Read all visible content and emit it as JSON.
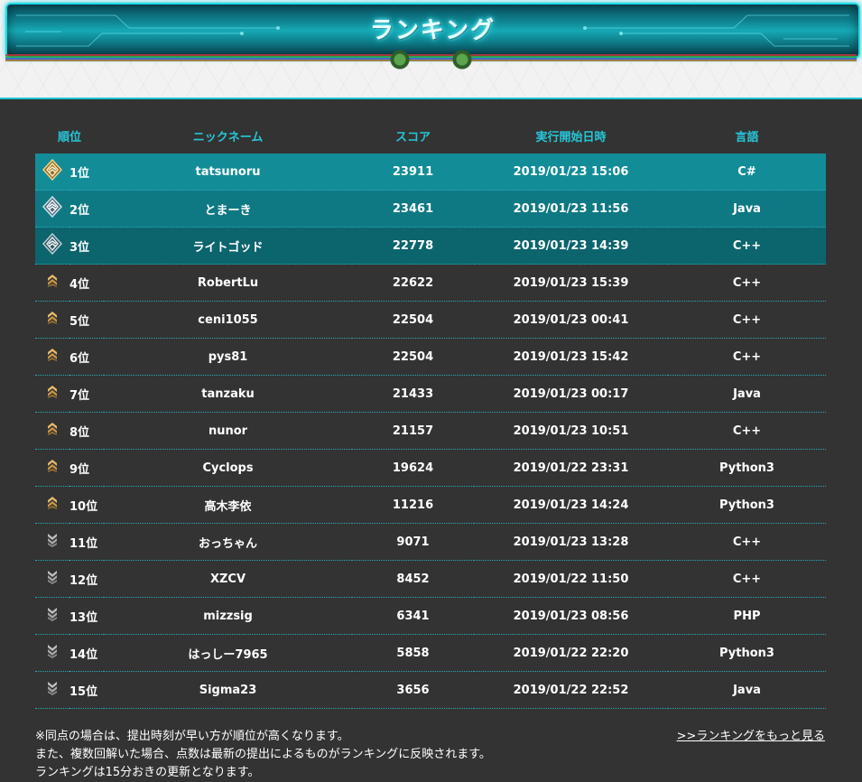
{
  "header": {
    "title": "ランキング"
  },
  "table": {
    "columns": [
      "順位",
      "ニックネーム",
      "スコア",
      "実行開始日時",
      "言語"
    ],
    "rows": [
      {
        "rank": "1位",
        "nickname": "tatsunoru",
        "score": "23911",
        "datetime": "2019/01/23 15:06",
        "language": "C#",
        "medal": "gold-medal-icon"
      },
      {
        "rank": "2位",
        "nickname": "とまーき",
        "score": "23461",
        "datetime": "2019/01/23 11:56",
        "language": "Java",
        "medal": "silver-medal-icon"
      },
      {
        "rank": "3位",
        "nickname": "ライトゴッド",
        "score": "22778",
        "datetime": "2019/01/23 14:39",
        "language": "C++",
        "medal": "bronze-medal-icon"
      },
      {
        "rank": "4位",
        "nickname": "RobertLu",
        "score": "22622",
        "datetime": "2019/01/23 15:39",
        "language": "C++",
        "medal": "gold-chevron-icon"
      },
      {
        "rank": "5位",
        "nickname": "ceni1055",
        "score": "22504",
        "datetime": "2019/01/23 00:41",
        "language": "C++",
        "medal": "gold-chevron-icon"
      },
      {
        "rank": "6位",
        "nickname": "pys81",
        "score": "22504",
        "datetime": "2019/01/23 15:42",
        "language": "C++",
        "medal": "gold-chevron-icon"
      },
      {
        "rank": "7位",
        "nickname": "tanzaku",
        "score": "21433",
        "datetime": "2019/01/23 00:17",
        "language": "Java",
        "medal": "gold-chevron-icon"
      },
      {
        "rank": "8位",
        "nickname": "nunor",
        "score": "21157",
        "datetime": "2019/01/23 10:51",
        "language": "C++",
        "medal": "gold-chevron-icon"
      },
      {
        "rank": "9位",
        "nickname": "Cyclops",
        "score": "19624",
        "datetime": "2019/01/22 23:31",
        "language": "Python3",
        "medal": "gold-chevron-icon"
      },
      {
        "rank": "10位",
        "nickname": "高木李依",
        "score": "11216",
        "datetime": "2019/01/23 14:24",
        "language": "Python3",
        "medal": "gold-chevron-icon"
      },
      {
        "rank": "11位",
        "nickname": "おっちゃん",
        "score": "9071",
        "datetime": "2019/01/23 13:28",
        "language": "C++",
        "medal": "silver-chevron-icon"
      },
      {
        "rank": "12位",
        "nickname": "XZCV",
        "score": "8452",
        "datetime": "2019/01/22 11:50",
        "language": "C++",
        "medal": "silver-chevron-icon"
      },
      {
        "rank": "13位",
        "nickname": "mizzsig",
        "score": "6341",
        "datetime": "2019/01/23 08:56",
        "language": "PHP",
        "medal": "silver-chevron-icon"
      },
      {
        "rank": "14位",
        "nickname": "はっしー7965",
        "score": "5858",
        "datetime": "2019/01/22 22:20",
        "language": "Python3",
        "medal": "silver-chevron-icon"
      },
      {
        "rank": "15位",
        "nickname": "Sigma23",
        "score": "3656",
        "datetime": "2019/01/22 22:52",
        "language": "Java",
        "medal": "silver-chevron-icon"
      }
    ]
  },
  "footer": {
    "notes": [
      "※同点の場合は、提出時刻が早い方が順位が高くなります。",
      "また、複数回解いた場合、点数は最新の提出によるものがランキングに反映されます。",
      "ランキングは15分おきの更新となります。"
    ],
    "more_link": ">>ランキングをもっと見る"
  },
  "colors": {
    "background": "#333333",
    "accent": "#26c6d8",
    "top1_row": "#128d98",
    "top2_row": "#0f7983",
    "top3_row": "#0c646d"
  }
}
